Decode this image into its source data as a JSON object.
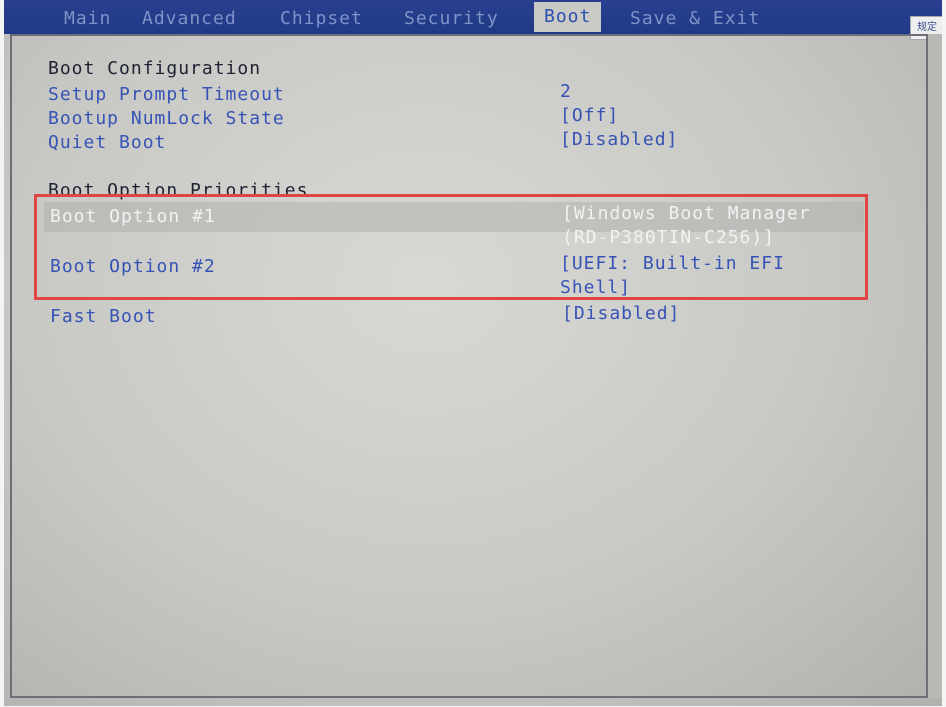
{
  "menu": {
    "tabs": [
      {
        "label": "Main"
      },
      {
        "label": "Advanced"
      },
      {
        "label": "Chipset"
      },
      {
        "label": "Security"
      },
      {
        "label": "Boot"
      },
      {
        "label": "Save & Exit"
      }
    ],
    "active_tab": "Boot"
  },
  "corner_label": "规定",
  "boot": {
    "section_configuration": "Boot Configuration",
    "setup_prompt_timeout": {
      "label": "Setup Prompt Timeout",
      "value": "2"
    },
    "bootup_numlock_state": {
      "label": "Bootup NumLock State",
      "value": "[Off]"
    },
    "quiet_boot": {
      "label": "Quiet Boot",
      "value": "[Disabled]"
    },
    "section_priorities": "Boot Option Priorities",
    "option1": {
      "label": "Boot Option #1",
      "value": "[Windows Boot Manager\n(RD-P380TIN-C256)]"
    },
    "option2": {
      "label": "Boot Option #2",
      "value": "[UEFI: Built-in EFI\nShell]"
    },
    "fast_boot": {
      "label": "Fast Boot",
      "value": "[Disabled]"
    }
  },
  "colors": {
    "menu_bar": "#1f3a86",
    "option_text": "#3653b5",
    "highlight_box": "#e04444",
    "background": "#c8c8c4"
  }
}
